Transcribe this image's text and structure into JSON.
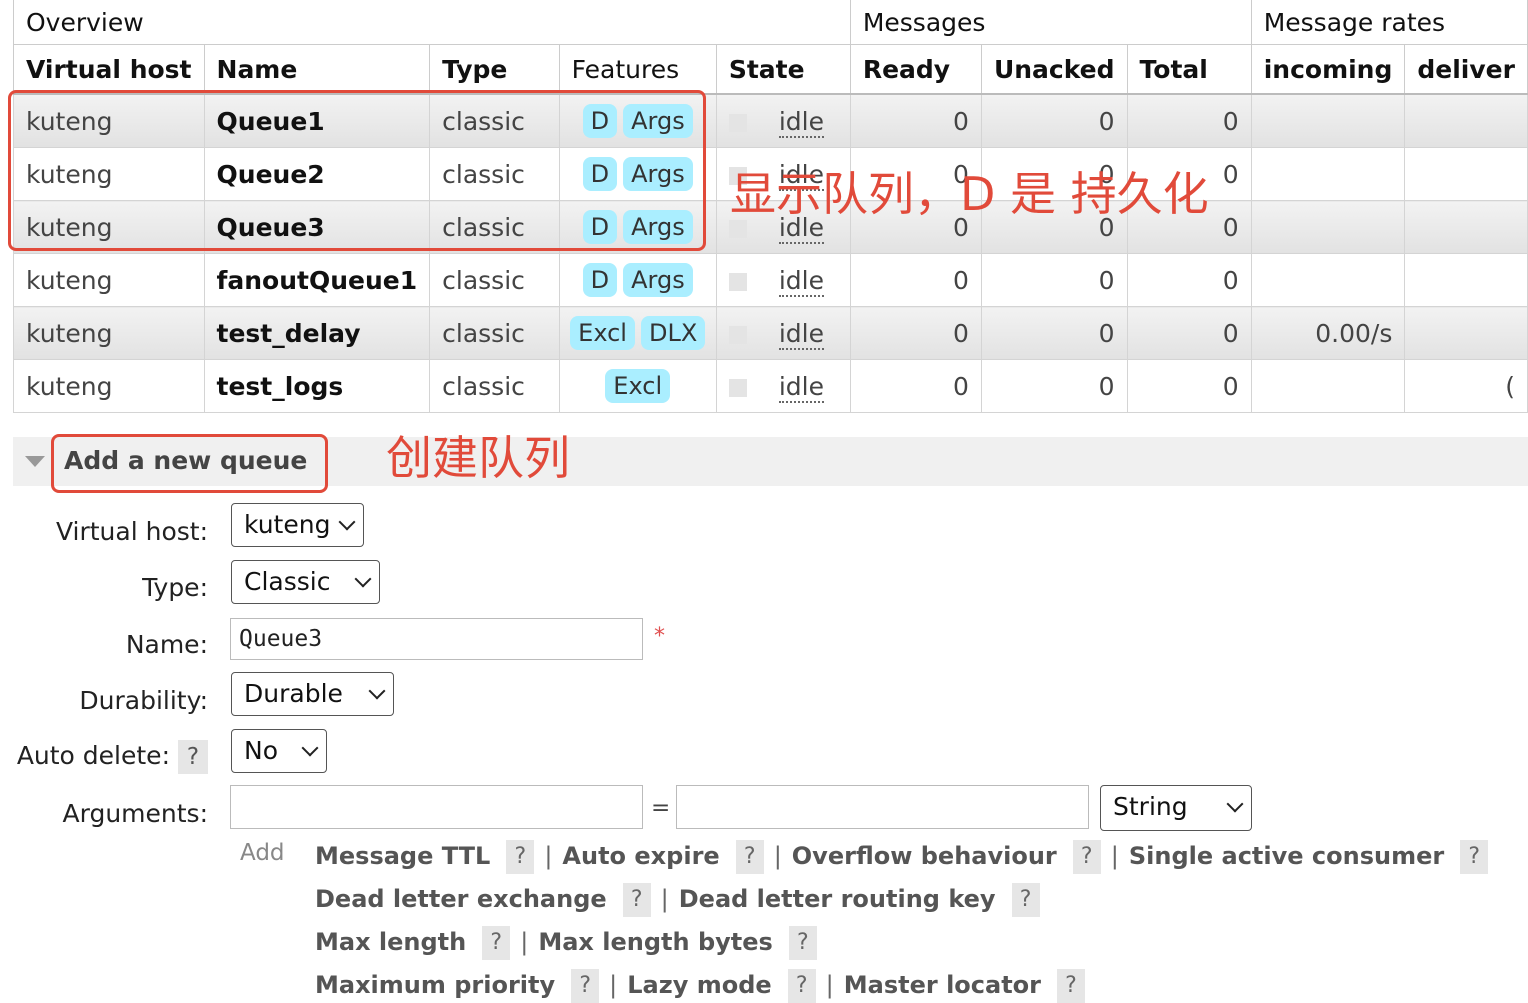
{
  "table": {
    "group_headers": [
      "Overview",
      "Messages",
      "Message rates"
    ],
    "columns": [
      "Virtual host",
      "Name",
      "Type",
      "Features",
      "State",
      "Ready",
      "Unacked",
      "Total",
      "incoming",
      "deliver"
    ],
    "rows": [
      {
        "vhost": "kuteng",
        "name": "Queue1",
        "type": "classic",
        "features": [
          "D",
          "Args"
        ],
        "state": "idle",
        "ready": "0",
        "unacked": "0",
        "total": "0",
        "incoming": "",
        "deliver": ""
      },
      {
        "vhost": "kuteng",
        "name": "Queue2",
        "type": "classic",
        "features": [
          "D",
          "Args"
        ],
        "state": "idle",
        "ready": "0",
        "unacked": "0",
        "total": "0",
        "incoming": "",
        "deliver": ""
      },
      {
        "vhost": "kuteng",
        "name": "Queue3",
        "type": "classic",
        "features": [
          "D",
          "Args"
        ],
        "state": "idle",
        "ready": "0",
        "unacked": "0",
        "total": "0",
        "incoming": "",
        "deliver": ""
      },
      {
        "vhost": "kuteng",
        "name": "fanoutQueue1",
        "type": "classic",
        "features": [
          "D",
          "Args"
        ],
        "state": "idle",
        "ready": "0",
        "unacked": "0",
        "total": "0",
        "incoming": "",
        "deliver": ""
      },
      {
        "vhost": "kuteng",
        "name": "test_delay",
        "type": "classic",
        "features": [
          "Excl",
          "DLX"
        ],
        "state": "idle",
        "ready": "0",
        "unacked": "0",
        "total": "0",
        "incoming": "0.00/s",
        "deliver": ""
      },
      {
        "vhost": "kuteng",
        "name": "test_logs",
        "type": "classic",
        "features": [
          "Excl"
        ],
        "state": "idle",
        "ready": "0",
        "unacked": "0",
        "total": "0",
        "incoming": "",
        "deliver": "("
      }
    ]
  },
  "annotations": {
    "durable_note": "显示队列，D 是 持久化",
    "create_note": "创建队列",
    "annotation_color": "#e14a3a"
  },
  "add_queue": {
    "title": "Add a new queue",
    "virtual_host_label": "Virtual host:",
    "virtual_host_value": "kuteng",
    "type_label": "Type:",
    "type_value": "Classic",
    "name_label": "Name:",
    "name_value": "Queue3",
    "required_mark": "*",
    "durability_label": "Durability:",
    "durability_value": "Durable",
    "auto_delete_label": "Auto delete:",
    "auto_delete_value": "No",
    "help_mark": "?",
    "arguments_label": "Arguments:",
    "equals": "=",
    "arg_type_value": "String",
    "add_label": "Add",
    "arg_links": [
      [
        "Message TTL",
        "Auto expire",
        "Overflow behaviour",
        "Single active consumer"
      ],
      [
        "Dead letter exchange",
        "Dead letter routing key"
      ],
      [
        "Max length",
        "Max length bytes"
      ],
      [
        "Maximum priority",
        "Lazy mode",
        "Master locator"
      ]
    ]
  },
  "colors": {
    "badge": "#aaeeff",
    "row_alt": "#eeeeee"
  }
}
